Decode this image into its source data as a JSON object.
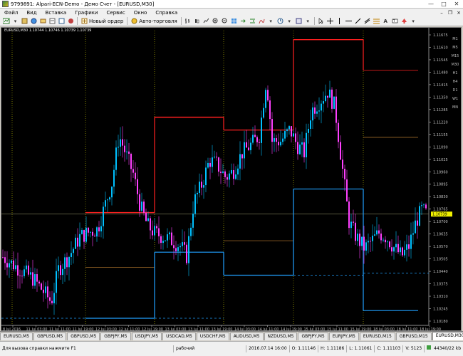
{
  "window": {
    "title": "9799891: Alpari-ECN-Demo - Демо Счет - [EURUSD,M30]",
    "min_label": "—",
    "max_label": "□",
    "close_label": "✕"
  },
  "menu": {
    "items": [
      "Файл",
      "Вид",
      "Вставка",
      "Графики",
      "Сервис",
      "Окно",
      "Справка"
    ]
  },
  "toolbar": {
    "new_order_label": "Новый ордер",
    "autotrade_label": "Авто-торговля"
  },
  "chart": {
    "info_label": "EURUSD,M30  1.10744 1.10746 1.10739 1.10739",
    "timeframes": [
      "M1",
      "M5",
      "M15",
      "M30",
      "H1",
      "H4",
      "D1",
      "W1",
      "MN"
    ],
    "price_labels": [
      "1.11675",
      "1.11610",
      "1.11545",
      "1.11480",
      "1.11415",
      "1.11350",
      "1.11285",
      "1.11220",
      "1.11155",
      "1.11090",
      "1.11025",
      "1.10960",
      "1.10895",
      "1.10830",
      "1.10765",
      "1.10739",
      "1.10700",
      "1.10635",
      "1.10570",
      "1.10505",
      "1.10440",
      "1.10375",
      "1.10310",
      "1.10245",
      "1.10180"
    ],
    "current_price": "1.10739",
    "time_labels": [
      "8 Jul 2016",
      "11 Jul 03:00",
      "11 Jul 11:00",
      "11 Jul 19:00",
      "12 Jul 03:00",
      "12 Jul 11:00",
      "12 Jul 19:00",
      "13 Jul 03:00",
      "13 Jul 11:00",
      "13 Jul 19:00",
      "14 Jul 03:00",
      "14 Jul 11:00",
      "14 Jul 19:00",
      "15 Jul 03:00",
      "15 Jul 11:00",
      "15 Jul 19:00",
      "18 Jul 03:00",
      "18 Jul 11:00",
      "18 Jul 19:00"
    ]
  },
  "symbol_tabs": [
    "EURUSD,M5",
    "GBPUSD,M5",
    "GBPUSD,M5",
    "GBPJPY,M5",
    "USDJPY,M5",
    "USDCAD,M5",
    "USDCHF,M5",
    "AUDUSD,M5",
    "NZDUSD,M5",
    "GBPJPY,M5",
    "EURJPY,M5",
    "EURUSD,M15",
    "GBPUSD,M15",
    "EURUSD,M30"
  ],
  "status": {
    "help": "Для вызова справки нажмите F1",
    "profile": "рабочий",
    "datetime": "2016.07.14 16:00",
    "open": "O: 1.11146",
    "high": "H: 1.11186",
    "low": "L: 1.11061",
    "close": "C: 1.11103",
    "volume": "V: 5123",
    "traffic": "44340/22 kb"
  },
  "colors": {
    "bg": "#000000",
    "bull": "#00c0ff",
    "bear": "#ff40ff",
    "level_red": "#ff2020",
    "level_blue": "#20a0ff",
    "level_orange": "#c08030",
    "grid": "#c8c800"
  }
}
